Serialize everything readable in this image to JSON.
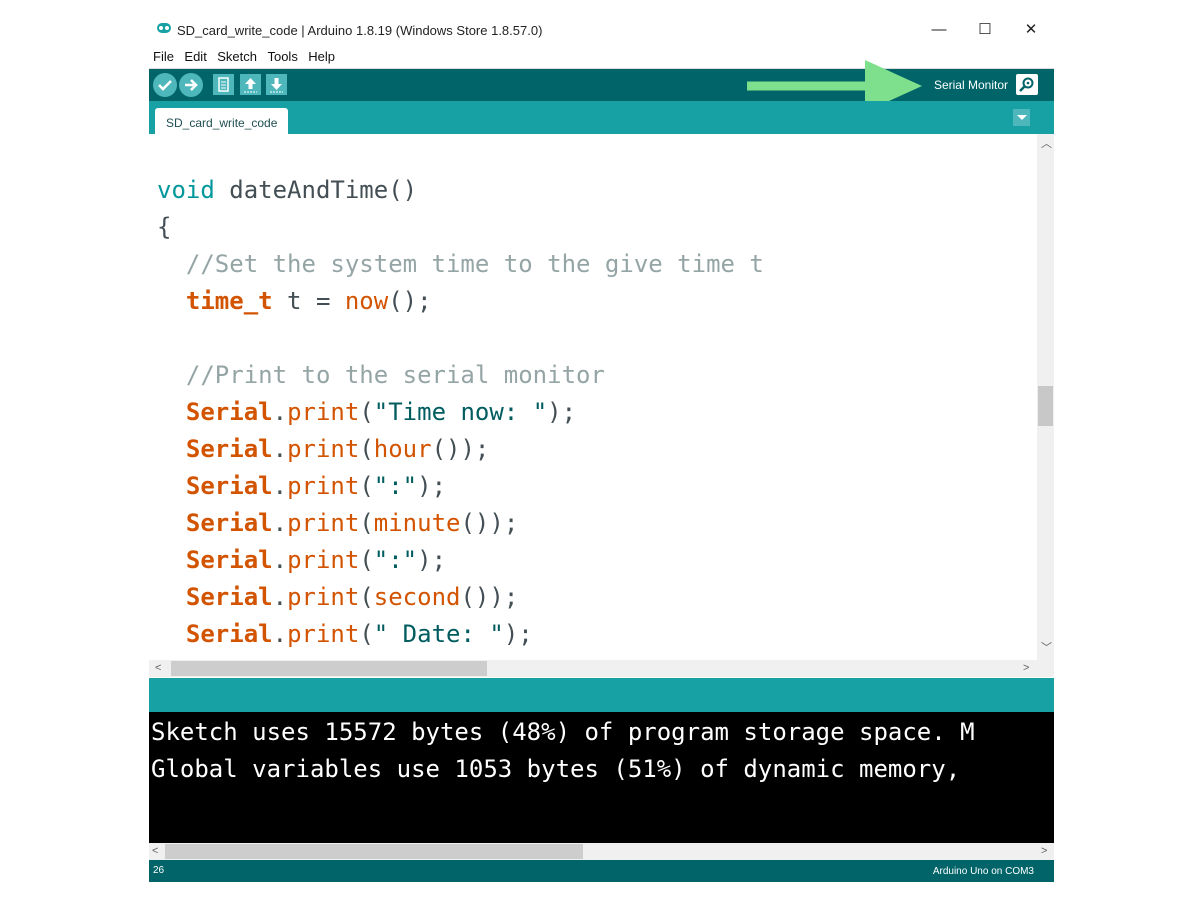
{
  "window": {
    "title": "SD_card_write_code | Arduino 1.8.19 (Windows Store 1.8.57.0)",
    "minimize": "—",
    "maximize": "☐",
    "close": "✕"
  },
  "menu": [
    "File",
    "Edit",
    "Sketch",
    "Tools",
    "Help"
  ],
  "toolbar": {
    "buttons": [
      "verify-icon",
      "upload-icon",
      "new-icon",
      "open-icon",
      "save-icon"
    ],
    "serial_monitor_label": "Serial Monitor",
    "serial_monitor_icon": "magnifier-icon",
    "annotation_color": "#7ee08d"
  },
  "tabs": [
    "SD_card_write_code"
  ],
  "editor": {
    "lines": [
      "void dateAndTime()",
      "{",
      "  //Set the system time to the give time t",
      "  time_t t = now();",
      "",
      "  //Print to the serial monitor",
      "  Serial.print(\"Time now: \");",
      "  Serial.print(hour());",
      "  Serial.print(\":\");",
      "  Serial.print(minute());",
      "  Serial.print(\":\");",
      "  Serial.print(second());",
      "  Serial.print(\" Date: \");"
    ]
  },
  "console": {
    "lines": [
      "Sketch uses 15572 bytes (48%) of program storage space. M",
      "Global variables use 1053 bytes (51%) of dynamic memory,"
    ]
  },
  "status": {
    "line_number": "26",
    "board": "Arduino Uno on COM3"
  },
  "colors": {
    "toolbar_dark": "#006468",
    "teal": "#17a1a5",
    "keyword_orange": "#d35400",
    "keyword_teal": "#00979c",
    "comment_gray": "#95a5a6"
  }
}
